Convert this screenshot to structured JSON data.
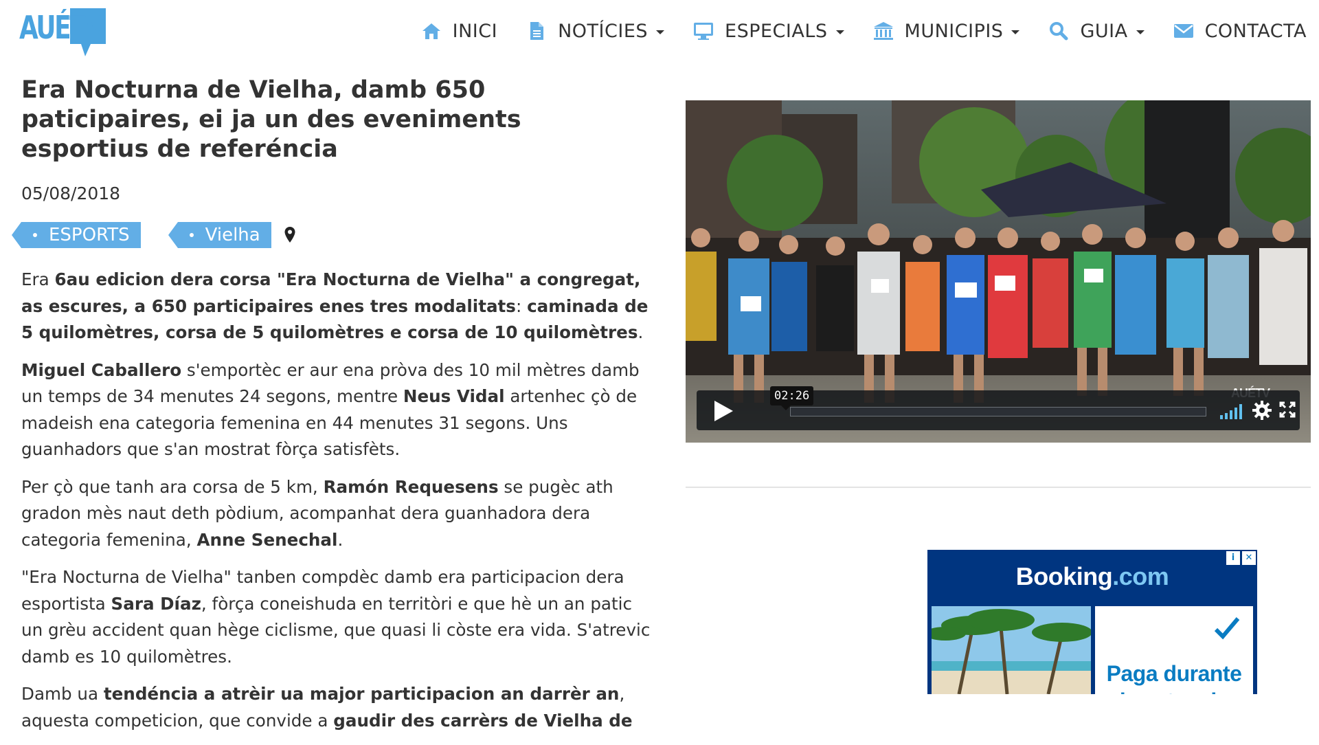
{
  "site": {
    "logo_text": "AUÉTV"
  },
  "nav": {
    "items": [
      {
        "label": "INICI",
        "icon": "home-icon",
        "dropdown": false
      },
      {
        "label": "NOTÍCIES",
        "icon": "document-icon",
        "dropdown": true
      },
      {
        "label": "ESPECIALS",
        "icon": "monitor-icon",
        "dropdown": true
      },
      {
        "label": "MUNICIPIS",
        "icon": "institution-icon",
        "dropdown": true
      },
      {
        "label": "GUIA",
        "icon": "search-icon",
        "dropdown": true
      },
      {
        "label": "CONTACTA",
        "icon": "envelope-icon",
        "dropdown": false
      }
    ]
  },
  "article": {
    "title": "Era Nocturna de Vielha, damb 650 paticipaires, ei ja un des eveniments esportius de referéncia",
    "date": "05/08/2018",
    "tags": [
      "ESPORTS",
      "Vielha"
    ],
    "paragraphs": [
      [
        {
          "t": "Era "
        },
        {
          "t": "6au edicion dera corsa \"Era Nocturna de Vielha\" a congregat, as escures, a 650 participaires enes tres modalitats",
          "b": true
        },
        {
          "t": ": "
        },
        {
          "t": "caminada de 5 quilomètres, corsa de 5 quilomètres e corsa de 10 quilomètres",
          "b": true
        },
        {
          "t": "."
        }
      ],
      [
        {
          "t": "Miguel Caballero",
          "b": true
        },
        {
          "t": " s'emportèc er aur ena pròva des 10 mil mètres damb un temps de 34 menutes 24 segons, mentre "
        },
        {
          "t": "Neus Vidal",
          "b": true
        },
        {
          "t": " artenhec çò de madeish ena categoria femenina en 44 menutes 31 segons. Uns guanhadors que s'an mostrat fòrça satisfèts."
        }
      ],
      [
        {
          "t": "Per çò que tanh ara corsa de 5 km, "
        },
        {
          "t": "Ramón Requesens",
          "b": true
        },
        {
          "t": " se pugèc ath gradon mès naut deth pòdium, acompanhat dera guanhadora dera categoria femenina, "
        },
        {
          "t": "Anne Senechal",
          "b": true
        },
        {
          "t": "."
        }
      ],
      [
        {
          "t": "\"Era Nocturna de Vielha\" tanben compdèc damb era participacion dera esportista "
        },
        {
          "t": "Sara Díaz",
          "b": true
        },
        {
          "t": ", fòrça coneishuda en territòri e que hè un an patic un grèu accident quan hège ciclisme, que quasi li còste era vida. S'atrevic damb es 10 quilomètres."
        }
      ],
      [
        {
          "t": "Damb ua "
        },
        {
          "t": "tendéncia a atrèir ua major participacion an darrèr an",
          "b": true
        },
        {
          "t": ", aquesta competicion, que convide a "
        },
        {
          "t": "gaudir des carrèrs de Vielha de",
          "b": true
        }
      ]
    ]
  },
  "video": {
    "timecode": "02:26",
    "progress_fraction": 0.0,
    "watermark": "AUÉTV",
    "colors": {
      "accent": "#61c0ee"
    }
  },
  "ad": {
    "brand_main": "Booking",
    "brand_suffix": ".com",
    "text_lines": [
      "Paga durante",
      "la estancia"
    ],
    "badges": [
      "i",
      "✕"
    ],
    "colors": {
      "brand": "#003580",
      "text": "#0a7cc2"
    }
  },
  "colors": {
    "accent": "#4aa3df",
    "tag": "#62aee6",
    "text": "#333333"
  }
}
